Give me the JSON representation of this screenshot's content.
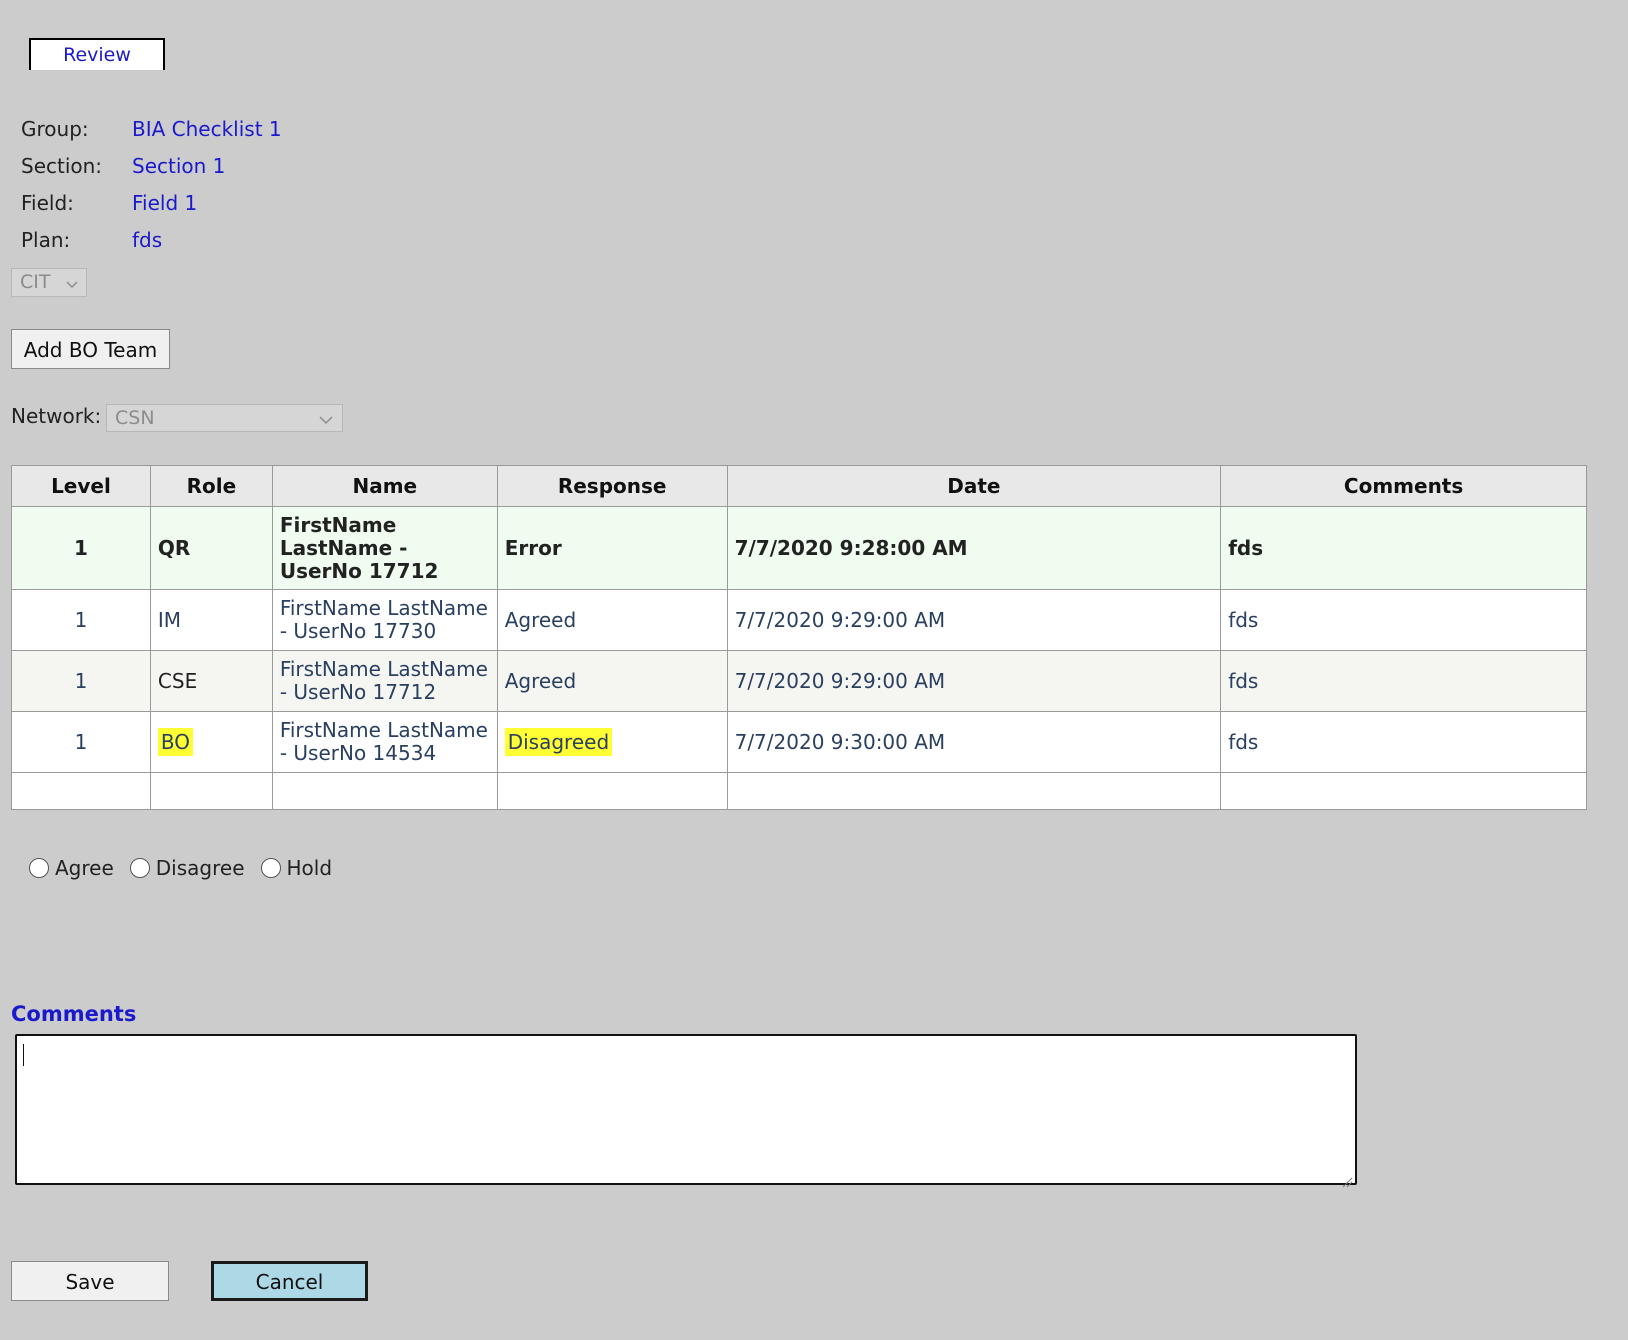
{
  "tab": {
    "label": "Review"
  },
  "info": [
    {
      "label": "Group:",
      "value": "BIA Checklist 1"
    },
    {
      "label": "Section:",
      "value": "Section 1"
    },
    {
      "label": "Field:",
      "value": "Field 1"
    },
    {
      "label": "Plan:",
      "value": "fds"
    }
  ],
  "cit_select": {
    "value": "CIT"
  },
  "add_bo_team": {
    "label": "Add BO Team"
  },
  "network": {
    "label": "Network:",
    "value": "CSN"
  },
  "table": {
    "headers": [
      "Level",
      "Role",
      "Name",
      "Response",
      "Date",
      "Comments"
    ],
    "rows": [
      {
        "level": "1",
        "role": "QR",
        "name": "FirstName LastName - UserNo 17712",
        "response": "Error",
        "date": "7/7/2020 9:28:00 AM",
        "comments": "fds"
      },
      {
        "level": "1",
        "role": "IM",
        "name": "FirstName LastName - UserNo 17730",
        "response": "Agreed",
        "date": "7/7/2020 9:29:00 AM",
        "comments": "fds"
      },
      {
        "level": "1",
        "role": "CSE",
        "name": "FirstName LastName - UserNo 17712",
        "response": "Agreed",
        "date": "7/7/2020 9:29:00 AM",
        "comments": "fds"
      },
      {
        "level": "1",
        "role": "BO",
        "name": "FirstName LastName - UserNo 14534",
        "response": "Disagreed",
        "date": "7/7/2020 9:30:00 AM",
        "comments": "fds"
      }
    ]
  },
  "radios": [
    {
      "label": "Agree"
    },
    {
      "label": "Disagree"
    },
    {
      "label": "Hold"
    }
  ],
  "comments": {
    "label": "Comments",
    "value": ""
  },
  "actions": {
    "save_label": "Save",
    "cancel_label": "Cancel"
  },
  "colors": {
    "link": "#1a1acc",
    "highlight": "#ffff33",
    "cancel_bg": "#add8e6",
    "first_row_bg": "#effcef"
  }
}
